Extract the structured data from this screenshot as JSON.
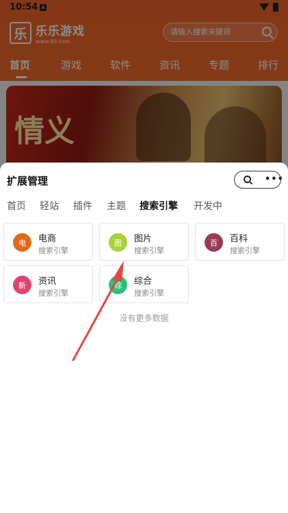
{
  "status_bar": {
    "time": "10:54"
  },
  "app_header": {
    "logo_char": "乐",
    "logo_title": "乐乐游戏",
    "logo_url": "www.6ll.com",
    "search_placeholder": "请输入搜索关键词"
  },
  "nav_tabs": [
    {
      "label": "首页",
      "active": true
    },
    {
      "label": "游戏",
      "active": false
    },
    {
      "label": "软件",
      "active": false
    },
    {
      "label": "资讯",
      "active": false
    },
    {
      "label": "专题",
      "active": false
    },
    {
      "label": "排行",
      "active": false
    }
  ],
  "banner": {
    "text": "情义"
  },
  "sheet": {
    "title": "扩展管理",
    "more_label": "•••",
    "tabs": [
      {
        "label": "首页",
        "active": false
      },
      {
        "label": "轻站",
        "active": false
      },
      {
        "label": "插件",
        "active": false
      },
      {
        "label": "主题",
        "active": false
      },
      {
        "label": "搜索引擎",
        "active": true
      },
      {
        "label": "开发中",
        "active": false
      }
    ],
    "items": [
      {
        "icon_char": "电",
        "name": "电商",
        "subtitle": "搜索引擎",
        "color": "#e2691a"
      },
      {
        "icon_char": "图",
        "name": "图片",
        "subtitle": "搜索引擎",
        "color": "#a8d23a"
      },
      {
        "icon_char": "百",
        "name": "百科",
        "subtitle": "搜索引擎",
        "color": "#9b3a55"
      },
      {
        "icon_char": "新",
        "name": "资讯",
        "subtitle": "搜索引擎",
        "color": "#e0446e"
      },
      {
        "icon_char": "综",
        "name": "综合",
        "subtitle": "搜索引擎",
        "color": "#2bbf7a"
      }
    ],
    "empty_text": "没有更多数据"
  },
  "colors": {
    "header_orange": "#f06428",
    "annotation_arrow": "#e8453c"
  }
}
